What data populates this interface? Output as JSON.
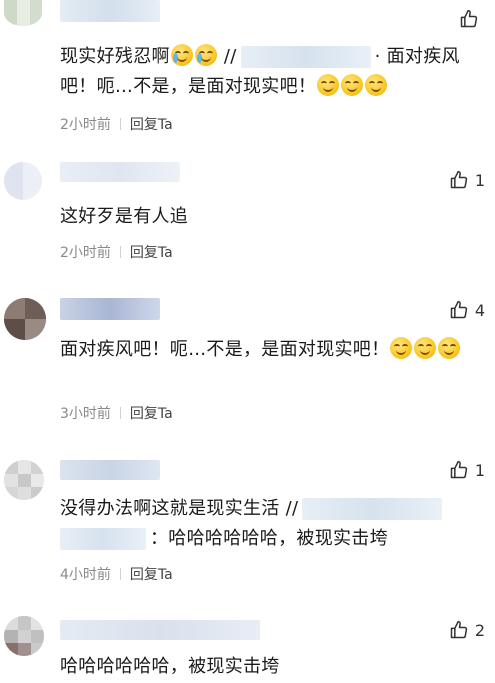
{
  "comments": [
    {
      "likes": "",
      "text_a": "现实好残忍啊",
      "text_b": " //",
      "text_c": "· 面对疾风吧！呃…不是，是面对现实吧！",
      "time": "2小时前",
      "reply": "回复Ta"
    },
    {
      "likes": "1",
      "text": "这好歹是有人追",
      "time": "2小时前",
      "reply": "回复Ta"
    },
    {
      "likes": "4",
      "text": "面对疾风吧！呃…不是，是面对现实吧！",
      "time": "3小时前",
      "reply": "回复Ta"
    },
    {
      "likes": "1",
      "text_a": "没得办法啊这就是现实生活 //",
      "text_b": "：哈哈哈哈哈哈，被现实击垮",
      "time": "4小时前",
      "reply": "回复Ta"
    },
    {
      "likes": "2",
      "text": "哈哈哈哈哈哈，被现实击垮"
    }
  ],
  "icons": {
    "like": "thumbs-up-outline-icon",
    "emoji_cry_laugh": "laugh-cry-emoji-icon",
    "emoji_smirk": "smirk-emoji-icon"
  },
  "colors": {
    "text": "#1a1a1a",
    "meta": "#8a8a8a",
    "separator": "#d0d0d0"
  }
}
